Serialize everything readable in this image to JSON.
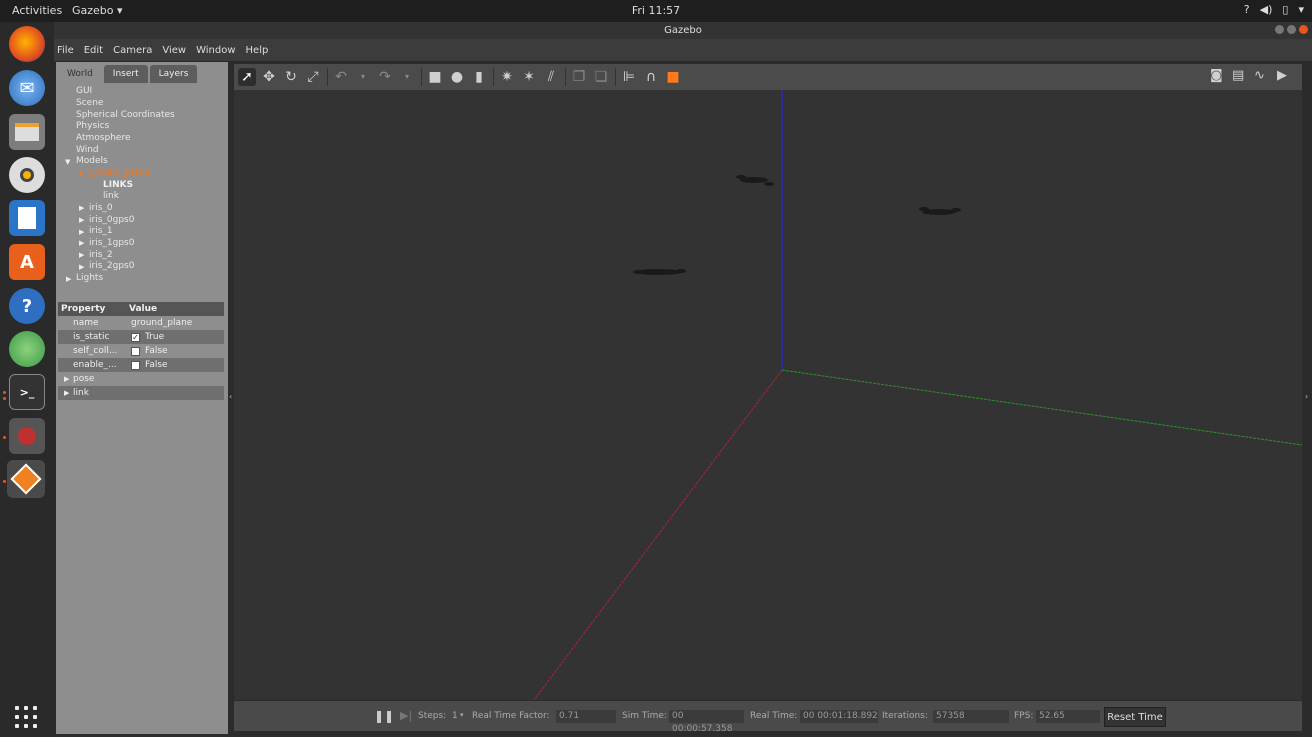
{
  "topbar": {
    "activities": "Activities",
    "app_menu": "Gazebo ▾",
    "clock": "Fri 11:57",
    "tray_icons": [
      "question-icon",
      "volume-icon",
      "battery-icon",
      "chevron-down-icon"
    ]
  },
  "dock": {
    "items": [
      "firefox-icon",
      "thunderbird-icon",
      "files-icon",
      "rhythmbox-icon",
      "writer-icon",
      "software-center-icon",
      "help-icon",
      "app-icon",
      "terminal-icon",
      "app-red-icon",
      "gazebo-icon"
    ],
    "show_apps": "apps-grid-icon"
  },
  "window": {
    "title": "Gazebo"
  },
  "menubar": {
    "items": [
      "File",
      "Edit",
      "Camera",
      "View",
      "Window",
      "Help"
    ]
  },
  "tabs": [
    "World",
    "Insert",
    "Layers"
  ],
  "tree": {
    "nodes": [
      "GUI",
      "Scene",
      "Spherical Coordinates",
      "Physics",
      "Atmosphere",
      "Wind",
      "Models",
      "ground_plane",
      "LINKS",
      "link",
      "iris_0",
      "iris_0gps0",
      "iris_1",
      "iris_1gps0",
      "iris_2",
      "iris_2gps0",
      "Lights"
    ]
  },
  "properties": {
    "header": {
      "property": "Property",
      "value": "Value"
    },
    "rows": [
      {
        "name": "name",
        "value": "ground_plane"
      },
      {
        "name": "is_static",
        "value": "True",
        "checked": true
      },
      {
        "name": "self_coll...",
        "value": "False",
        "checked": false
      },
      {
        "name": "enable_...",
        "value": "False",
        "checked": false
      }
    ],
    "groups": [
      "pose",
      "link"
    ]
  },
  "toolbar": {
    "tools": [
      "select-arrow-icon",
      "translate-icon",
      "rotate-icon",
      "scale-icon",
      "undo-icon",
      "redo-icon",
      "box-icon",
      "sphere-icon",
      "cylinder-icon",
      "point-light-icon",
      "spot-light-icon",
      "directional-light-icon",
      "copy-icon",
      "paste-icon",
      "align-icon",
      "snap-icon",
      "orange-shape-icon"
    ],
    "right_tools": [
      "screenshot-icon",
      "log-icon",
      "plot-icon",
      "video-icon"
    ]
  },
  "bottombar": {
    "steps_label": "Steps:",
    "steps_value": "1",
    "rtf_label": "Real Time Factor:",
    "rtf_value": "0.71",
    "sim_time_label": "Sim Time:",
    "sim_time_value": "00 00:00:57.358",
    "real_time_label": "Real Time:",
    "real_time_value": "00 00:01:18.892",
    "iterations_label": "Iterations:",
    "iterations_value": "57358",
    "fps_label": "FPS:",
    "fps_value": "52.65",
    "reset_label": "Reset Time"
  },
  "colors": {
    "x_axis": "#a8243a",
    "y_axis": "#2f8f2f",
    "z_axis": "#2a2ab4",
    "selected": "#e87a2a"
  }
}
